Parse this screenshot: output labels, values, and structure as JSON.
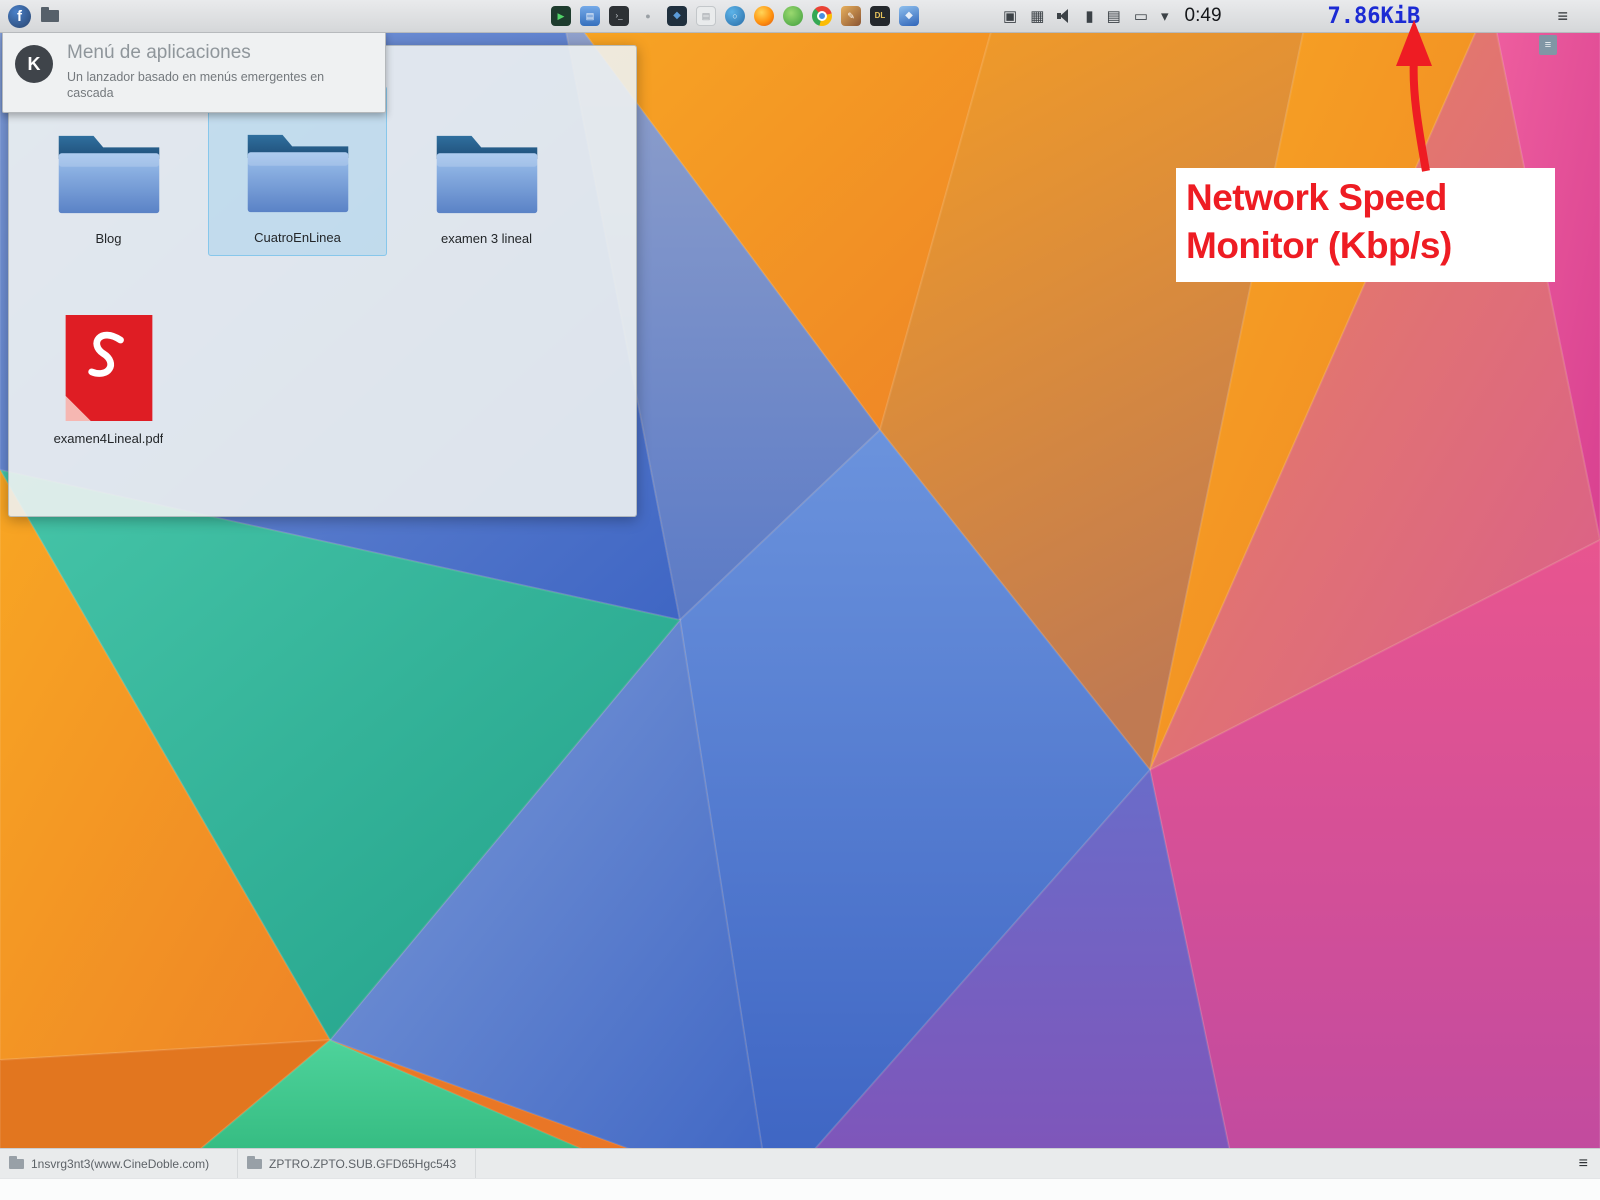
{
  "top_panel": {
    "clock": "0:49",
    "network_speed": "7.86KiB"
  },
  "launcher_tooltip": {
    "title": "Menú de aplicaciones",
    "description": "Un lanzador basado en menús emergentes en cascada"
  },
  "desktop_popup": {
    "items": [
      {
        "label": "Blog",
        "type": "folder",
        "selected": false
      },
      {
        "label": "CuatroEnLinea",
        "type": "folder",
        "selected": true
      },
      {
        "label": "examen 3 lineal",
        "type": "folder",
        "selected": false
      },
      {
        "label": "examen4Lineal.pdf",
        "type": "pdf-document",
        "selected": false
      }
    ]
  },
  "annotation": {
    "line1": "Network Speed",
    "line2": "Monitor (Kbp/s)",
    "color": "#ee1c23"
  },
  "taskbar": {
    "tasks": [
      "1nsvrg3nt3(www.CineDoble.com)",
      "ZPTRO.ZPTO.SUB.GFD65Hgc543"
    ]
  },
  "colors": {
    "network_speed_text": "#1c2bd4",
    "annotation_red": "#ee1c23",
    "selection_highlight": "#3daee9",
    "pdf_icon_red": "#df1d24"
  },
  "icons": {
    "launcher_glyph": "f",
    "media_player": "▶",
    "file_manager": "▤",
    "terminal": "›_",
    "dot": "●",
    "package": "◆",
    "notes": "▤",
    "web": "○",
    "art": "✎",
    "download": "DL",
    "cube": "◆",
    "tray_media": "▣",
    "tray_grid": "▦",
    "tray_device": "▮",
    "tray_clipboard": "▤",
    "tray_display": "▭",
    "tray_chevron": "▾",
    "hamburger": "≡",
    "handle": "≡",
    "taskbar_menu": "≡",
    "kde_logo_letter": "K"
  }
}
